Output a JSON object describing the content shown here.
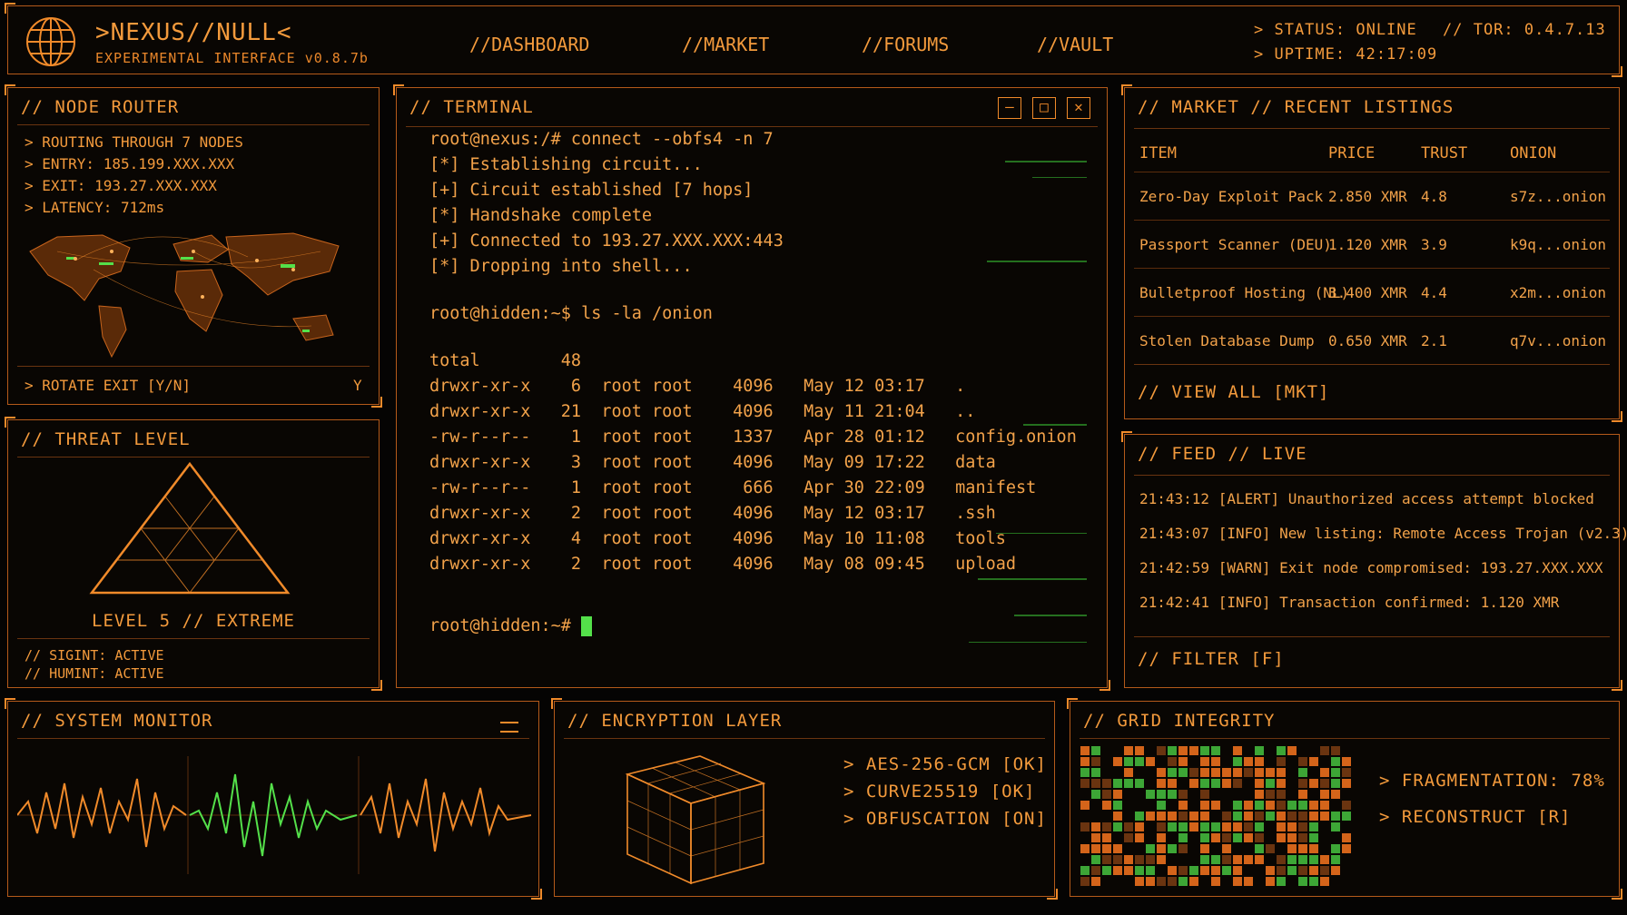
{
  "header": {
    "brand": ">NEXUS//NULL<",
    "subtitle": "EXPERIMENTAL INTERFACE v0.8.7b",
    "nav": [
      "//DASHBOARD",
      "//MARKET",
      "//FORUMS",
      "//VAULT"
    ],
    "status": "> STATUS: ONLINE",
    "tor": "// TOR: 0.4.7.13",
    "uptime": "> UPTIME: 42:17:09"
  },
  "router": {
    "title": "// NODE ROUTER",
    "lines": [
      "> ROUTING THROUGH 7 NODES",
      "> ENTRY: 185.199.XXX.XXX",
      "> EXIT: 193.27.XXX.XXX",
      "> LATENCY: 712ms"
    ],
    "rotate_label": "> ROTATE EXIT [Y/N]",
    "rotate_value": "Y"
  },
  "threat": {
    "title": "// THREAT LEVEL",
    "level": "LEVEL 5 // EXTREME",
    "sigint": "// SIGINT: ACTIVE",
    "humint": "// HUMINT: ACTIVE"
  },
  "terminal": {
    "title": "// TERMINAL",
    "buttons": [
      "—",
      "□",
      "✕"
    ],
    "lines": [
      "root@nexus:/# connect --obfs4 -n 7",
      "[*] Establishing circuit...",
      "[+] Circuit established [7 hops]",
      "[*] Handshake complete",
      "[+] Connected to 193.27.XXX.XXX:443",
      "[*] Dropping into shell...",
      "",
      "root@hidden:~$ ls -la /onion",
      "",
      "total        48",
      "drwxr-xr-x    6  root root    4096   May 12 03:17   .",
      "drwxr-xr-x   21  root root    4096   May 11 21:04   ..",
      "-rw-r--r--    1  root root    1337   Apr 28 01:12   config.onion",
      "drwxr-xr-x    3  root root    4096   May 09 17:22   data",
      "-rw-r--r--    1  root root     666   Apr 30 22:09   manifest",
      "drwxr-xr-x    2  root root    4096   May 12 03:17   .ssh",
      "drwxr-xr-x    4  root root    4096   May 10 11:08   tools",
      "drwxr-xr-x    2  root root    4096   May 08 09:45   upload"
    ],
    "prompt": "root@hidden:~#"
  },
  "market": {
    "title": "// MARKET // RECENT LISTINGS",
    "columns": [
      "ITEM",
      "PRICE",
      "TRUST",
      "ONION"
    ],
    "rows": [
      [
        "Zero-Day Exploit Pack",
        "2.850 XMR",
        "4.8",
        "s7z...onion"
      ],
      [
        "Passport Scanner (DEU)",
        "1.120 XMR",
        "3.9",
        "k9q...onion"
      ],
      [
        "Bulletproof Hosting (NL)",
        "3.400 XMR",
        "4.4",
        "x2m...onion"
      ],
      [
        "Stolen Database Dump",
        "0.650 XMR",
        "2.1",
        "q7v...onion"
      ]
    ],
    "view_all": "// VIEW ALL [MKT]"
  },
  "feed": {
    "title": "// FEED // LIVE",
    "lines": [
      "21:43:12 [ALERT] Unauthorized access attempt blocked",
      "21:43:07 [INFO] New listing: Remote Access Trojan (v2.3)",
      "21:42:59 [WARN] Exit node compromised: 193.27.XXX.XXX",
      "21:42:41 [INFO] Transaction confirmed: 1.120 XMR"
    ],
    "filter": "// FILTER [F]"
  },
  "sysmon": {
    "title": "// SYSTEM MONITOR"
  },
  "encryption": {
    "title": "// ENCRYPTION LAYER",
    "lines": [
      "> AES-256-GCM [OK]",
      "> CURVE25519 [OK]",
      "> OBFUSCATION [ON]"
    ]
  },
  "grid": {
    "title": "// GRID INTEGRITY",
    "fragmentation": "> FRAGMENTATION: 78%",
    "reconstruct": "> RECONSTRUCT [R]"
  },
  "colors": {
    "accent": "#f08a2a",
    "signal": "#54e04a",
    "background": "#050403"
  }
}
